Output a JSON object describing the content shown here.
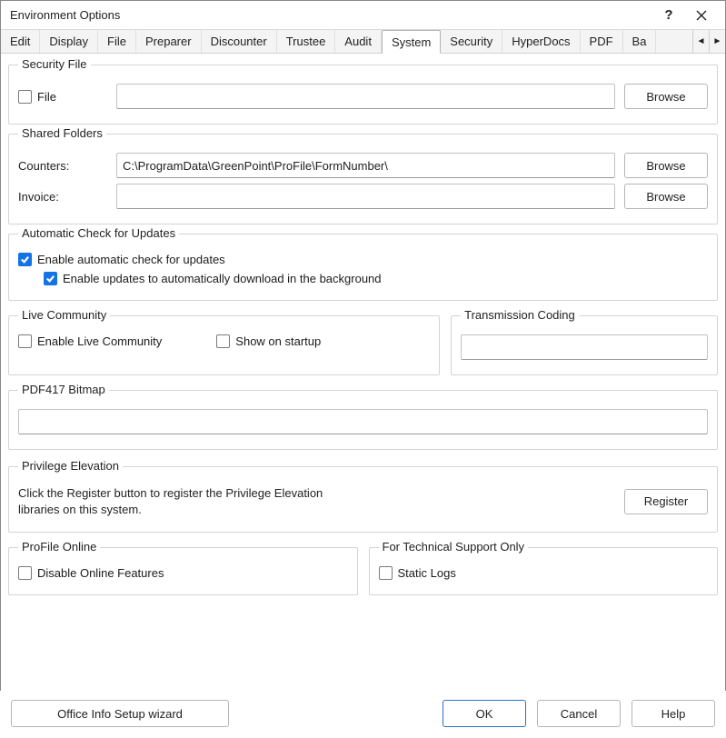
{
  "window": {
    "title": "Environment Options"
  },
  "tabs": {
    "items": [
      {
        "label": "Edit"
      },
      {
        "label": "Display"
      },
      {
        "label": "File"
      },
      {
        "label": "Preparer"
      },
      {
        "label": "Discounter"
      },
      {
        "label": "Trustee"
      },
      {
        "label": "Audit"
      },
      {
        "label": "System"
      },
      {
        "label": "Security"
      },
      {
        "label": "HyperDocs"
      },
      {
        "label": "PDF"
      },
      {
        "label": "Ba"
      }
    ],
    "active_index": 7
  },
  "security_file": {
    "legend": "Security File",
    "file_checkbox_label": "File",
    "file_value": "",
    "browse_label": "Browse"
  },
  "shared_folders": {
    "legend": "Shared Folders",
    "counters_label": "Counters:",
    "counters_value": "C:\\ProgramData\\GreenPoint\\ProFile\\FormNumber\\",
    "invoice_label": "Invoice:",
    "invoice_value": "",
    "browse_label": "Browse"
  },
  "updates": {
    "legend": "Automatic Check for Updates",
    "enable_label": "Enable automatic check for updates",
    "download_label": "Enable updates to automatically download in the background"
  },
  "live_community": {
    "legend": "Live Community",
    "enable_label": "Enable Live Community",
    "show_label": "Show on startup"
  },
  "transmission": {
    "legend": "Transmission Coding",
    "value": ""
  },
  "pdf417": {
    "legend": "PDF417 Bitmap",
    "value": ""
  },
  "privilege": {
    "legend": "Privilege Elevation",
    "text": "Click the Register button to register the Privilege Elevation libraries on this system.",
    "register_label": "Register"
  },
  "profile_online": {
    "legend": "ProFile Online",
    "disable_label": "Disable Online Features"
  },
  "tech_support": {
    "legend": "For Technical Support Only",
    "static_logs_label": "Static Logs"
  },
  "footer": {
    "wizard_label": "Office Info Setup wizard",
    "ok_label": "OK",
    "cancel_label": "Cancel",
    "help_label": "Help"
  }
}
